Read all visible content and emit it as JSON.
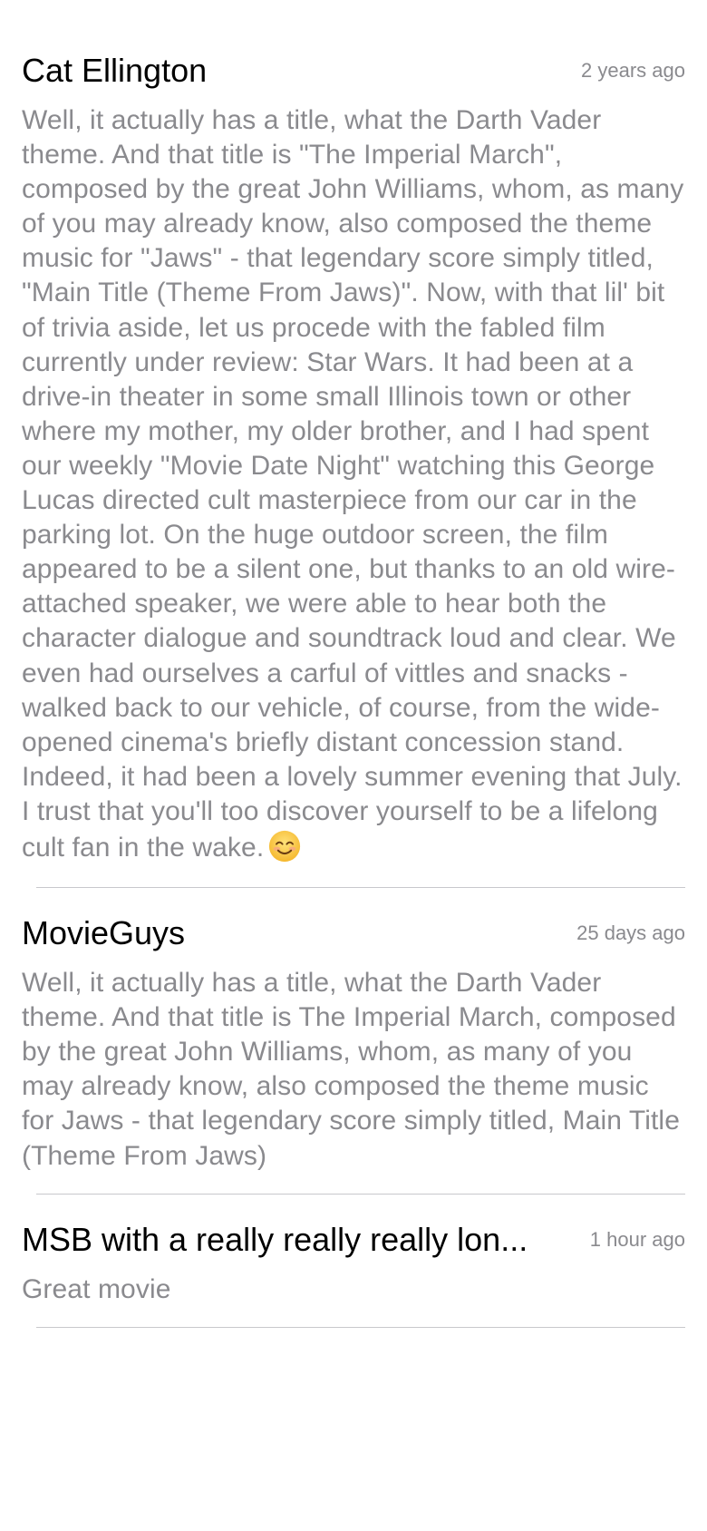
{
  "comments": [
    {
      "author": "Cat Ellington",
      "time": "2 years ago",
      "text": "Well, it actually has a title, what the Darth Vader theme. And that title is \"The Imperial March\", composed by the great John Williams, whom, as many of you may already know, also composed the theme music for \"Jaws\" - that legendary score simply titled, \"Main Title (Theme From Jaws)\". Now, with that lil' bit of trivia aside, let us procede with the fabled film currently under review: Star Wars. It had been at a drive-in theater in some small Illinois town or other where my mother, my older brother, and I had spent our weekly \"Movie Date Night\" watching this George Lucas directed cult masterpiece from our car in the parking lot. On the huge outdoor screen, the film appeared to be a silent one, but thanks to an old wire-attached speaker, we were able to hear both the character dialogue and soundtrack loud and clear. We even had ourselves a carful of vittles and snacks - walked back to our vehicle, of course, from the wide-opened cinema's briefly distant concession stand. Indeed, it had been a lovely summer evening that July. I trust that you'll too discover yourself to be a lifelong cult fan in the wake.",
      "emoji": "smiling-face-icon"
    },
    {
      "author": "MovieGuys",
      "time": "25 days ago",
      "text": "Well, it actually has a title, what the Darth Vader theme. And that title is The Imperial March, composed by the great John Williams, whom, as many of you may already know, also composed the theme music for Jaws - that legendary score simply titled, Main Title (Theme From Jaws)"
    },
    {
      "author": "MSB with a really really really lon...",
      "time": "1 hour ago",
      "text": "Great movie"
    }
  ],
  "colors": {
    "author": "#000000",
    "secondary_text": "#8a8a8e",
    "separator": "#c8c8cc",
    "background": "#ffffff"
  }
}
